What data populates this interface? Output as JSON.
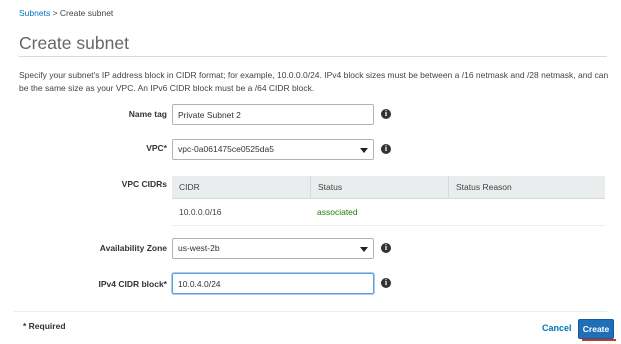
{
  "breadcrumb": {
    "parent": "Subnets",
    "separator": " > ",
    "current": "Create subnet"
  },
  "page_title": "Create subnet",
  "description": "Specify your subnet's IP address block in CIDR format; for example, 10.0.0.0/24. IPv4 block sizes must be between a /16 netmask and /28 netmask, and can be the same size as your VPC. An IPv6 CIDR block must be a /64 CIDR block.",
  "form": {
    "name_tag": {
      "label": "Name tag",
      "value": "Private Subnet 2"
    },
    "vpc": {
      "label": "VPC*",
      "value": "vpc-0a061475ce0525da5"
    },
    "vpc_cidrs": {
      "label": "VPC CIDRs",
      "columns": [
        "CIDR",
        "Status",
        "Status Reason"
      ],
      "rows": [
        {
          "cidr": "10.0.0.0/16",
          "status": "associated",
          "reason": ""
        }
      ]
    },
    "availability_zone": {
      "label": "Availability Zone",
      "value": "us-west-2b"
    },
    "ipv4_cidr": {
      "label": "IPv4 CIDR block*",
      "value": "10.0.4.0/24"
    }
  },
  "footer": {
    "required_note": "* Required",
    "cancel_label": "Cancel",
    "create_label": "Create"
  },
  "icons": {
    "info": "info-icon",
    "dropdown": "chevron-down-icon"
  },
  "colors": {
    "link": "#0073bb",
    "primary_button": "#1f6fb8",
    "status_ok": "#1d8102"
  }
}
